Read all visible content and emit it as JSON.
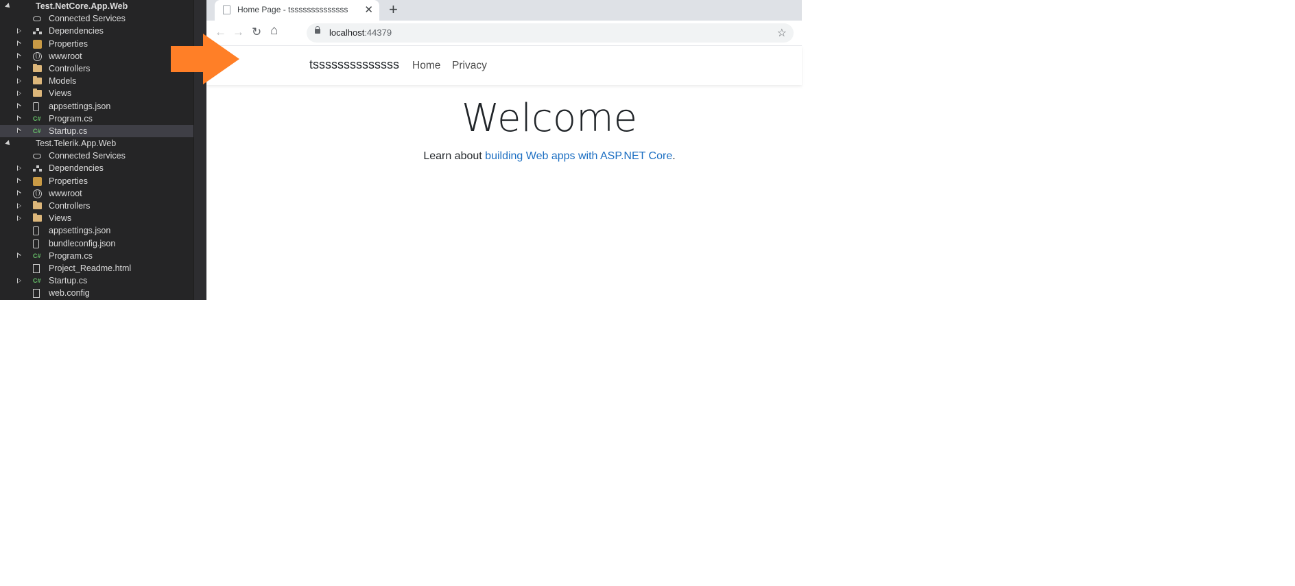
{
  "solution_explorer": {
    "items": [
      {
        "label": "Test.NetCore.App.Web",
        "type": "project",
        "arrow": "expanded",
        "level": 0,
        "bold": true
      },
      {
        "label": "Connected Services",
        "type": "cloud",
        "arrow": "none",
        "level": 1
      },
      {
        "label": "Dependencies",
        "type": "deps",
        "arrow": "collapsed",
        "level": 1
      },
      {
        "label": "Properties",
        "type": "wrench",
        "arrow": "collapsed",
        "level": 1
      },
      {
        "label": "wwwroot",
        "type": "globe",
        "arrow": "collapsed",
        "level": 1
      },
      {
        "label": "Controllers",
        "type": "folder",
        "arrow": "collapsed",
        "level": 1
      },
      {
        "label": "Models",
        "type": "folder",
        "arrow": "collapsed",
        "level": 1
      },
      {
        "label": "Views",
        "type": "folder",
        "arrow": "collapsed",
        "level": 1
      },
      {
        "label": "appsettings.json",
        "type": "json",
        "arrow": "collapsed",
        "level": 1
      },
      {
        "label": "Program.cs",
        "type": "cs",
        "arrow": "collapsed",
        "level": 1
      },
      {
        "label": "Startup.cs",
        "type": "cs",
        "arrow": "collapsed",
        "level": 1,
        "selected": true
      },
      {
        "label": "Test.Telerik.App.Web",
        "type": "project",
        "arrow": "expanded",
        "level": 0,
        "bold": false
      },
      {
        "label": "Connected Services",
        "type": "cloud",
        "arrow": "none",
        "level": 1
      },
      {
        "label": "Dependencies",
        "type": "deps",
        "arrow": "collapsed",
        "level": 1
      },
      {
        "label": "Properties",
        "type": "wrench",
        "arrow": "collapsed",
        "level": 1
      },
      {
        "label": "wwwroot",
        "type": "globe",
        "arrow": "collapsed",
        "level": 1
      },
      {
        "label": "Controllers",
        "type": "folder",
        "arrow": "collapsed",
        "level": 1
      },
      {
        "label": "Views",
        "type": "folder",
        "arrow": "collapsed",
        "level": 1
      },
      {
        "label": "appsettings.json",
        "type": "json",
        "arrow": "none",
        "level": 1
      },
      {
        "label": "bundleconfig.json",
        "type": "json",
        "arrow": "none",
        "level": 1
      },
      {
        "label": "Program.cs",
        "type": "cs",
        "arrow": "collapsed",
        "level": 1
      },
      {
        "label": "Project_Readme.html",
        "type": "file",
        "arrow": "none",
        "level": 1
      },
      {
        "label": "Startup.cs",
        "type": "cs",
        "arrow": "collapsed",
        "level": 1
      },
      {
        "label": "web.config",
        "type": "file",
        "arrow": "none",
        "level": 1
      }
    ]
  },
  "browser": {
    "tab": {
      "title": "Home Page - tssssssssssssss",
      "close": "✕"
    },
    "new_tab": "+",
    "toolbar": {
      "back": "←",
      "forward": "→",
      "reload": "↻",
      "home": "⌂",
      "star": "☆"
    },
    "url": {
      "host": "localhost",
      "port": ":44379"
    }
  },
  "page": {
    "brand": "tssssssssssssss",
    "nav": [
      {
        "label": "Home"
      },
      {
        "label": "Privacy"
      }
    ],
    "heading": "Welcome",
    "learn_prefix": "Learn about ",
    "learn_link": "building Web apps with ASP.NET Core",
    "learn_suffix": "."
  },
  "colors": {
    "arrow": "#ff7f27",
    "link": "#1b6ec2",
    "ide_background": "#252526"
  }
}
